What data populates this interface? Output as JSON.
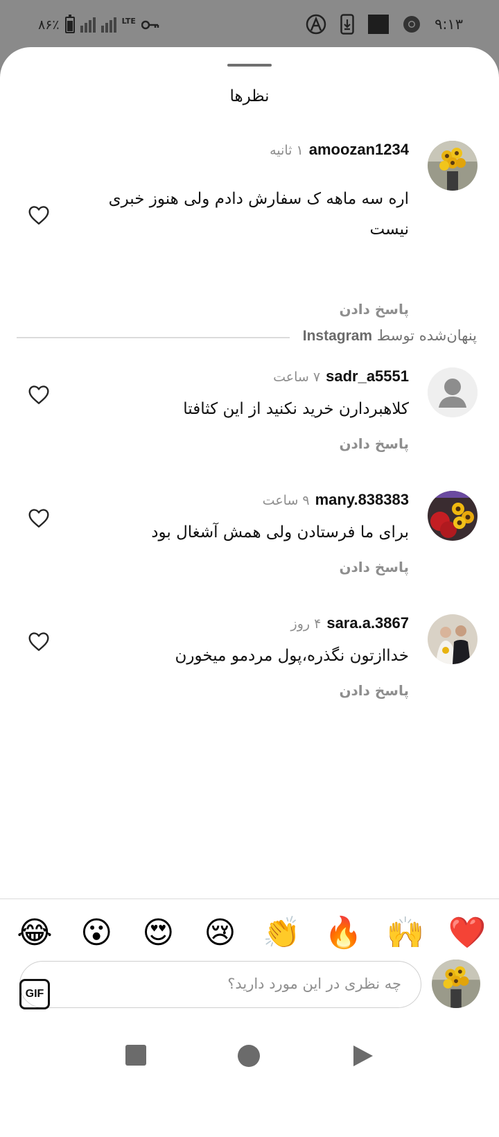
{
  "status_bar": {
    "battery": "۸۶٪",
    "network": "LTE",
    "time": "۹:۱۳"
  },
  "sheet": {
    "title": "نظرها"
  },
  "comments": [
    {
      "username": "amoozan1234",
      "time": "۱ ثانیه",
      "text_line1": "اره سه ماهه ک سفارش دادم ولی هنوز خبری",
      "text_line2": "نیست",
      "reply": "پاسخ دادن",
      "avatar": "sunflower-bouquet-photo"
    },
    {
      "username": "sadr_a5551",
      "time": "۷ ساعت",
      "text_line1": "کلاهبردارن خرید نکنید از این کثافتا",
      "reply": "پاسخ دادن",
      "avatar": "default-profile-icon"
    },
    {
      "username": "many.838383",
      "time": "۹ ساعت",
      "text_line1": "برای ما فرستادن ولی همش آشغال بود",
      "reply": "پاسخ دادن",
      "avatar": "flowers-photo"
    },
    {
      "username": "sara.a.3867",
      "time": "۴ روز",
      "text_line1": "خداازتون نگذره،پول مردمو میخورن",
      "reply": "پاسخ دادن",
      "avatar": "wedding-couple-photo"
    }
  ],
  "hidden_notice": {
    "prefix": "پنهان‌شده توسط",
    "brand": "Instagram"
  },
  "emojis": [
    "❤️",
    "🙌",
    "🔥",
    "👏",
    "😢",
    "😍",
    "😮",
    "😂"
  ],
  "composer": {
    "placeholder": "چه نظری در این مورد دارید؟",
    "gif_label": "GIF"
  },
  "colors": {
    "heart_outline": "#262626",
    "secondary_text": "#8e8e8e",
    "divider": "#dbdbdb"
  }
}
